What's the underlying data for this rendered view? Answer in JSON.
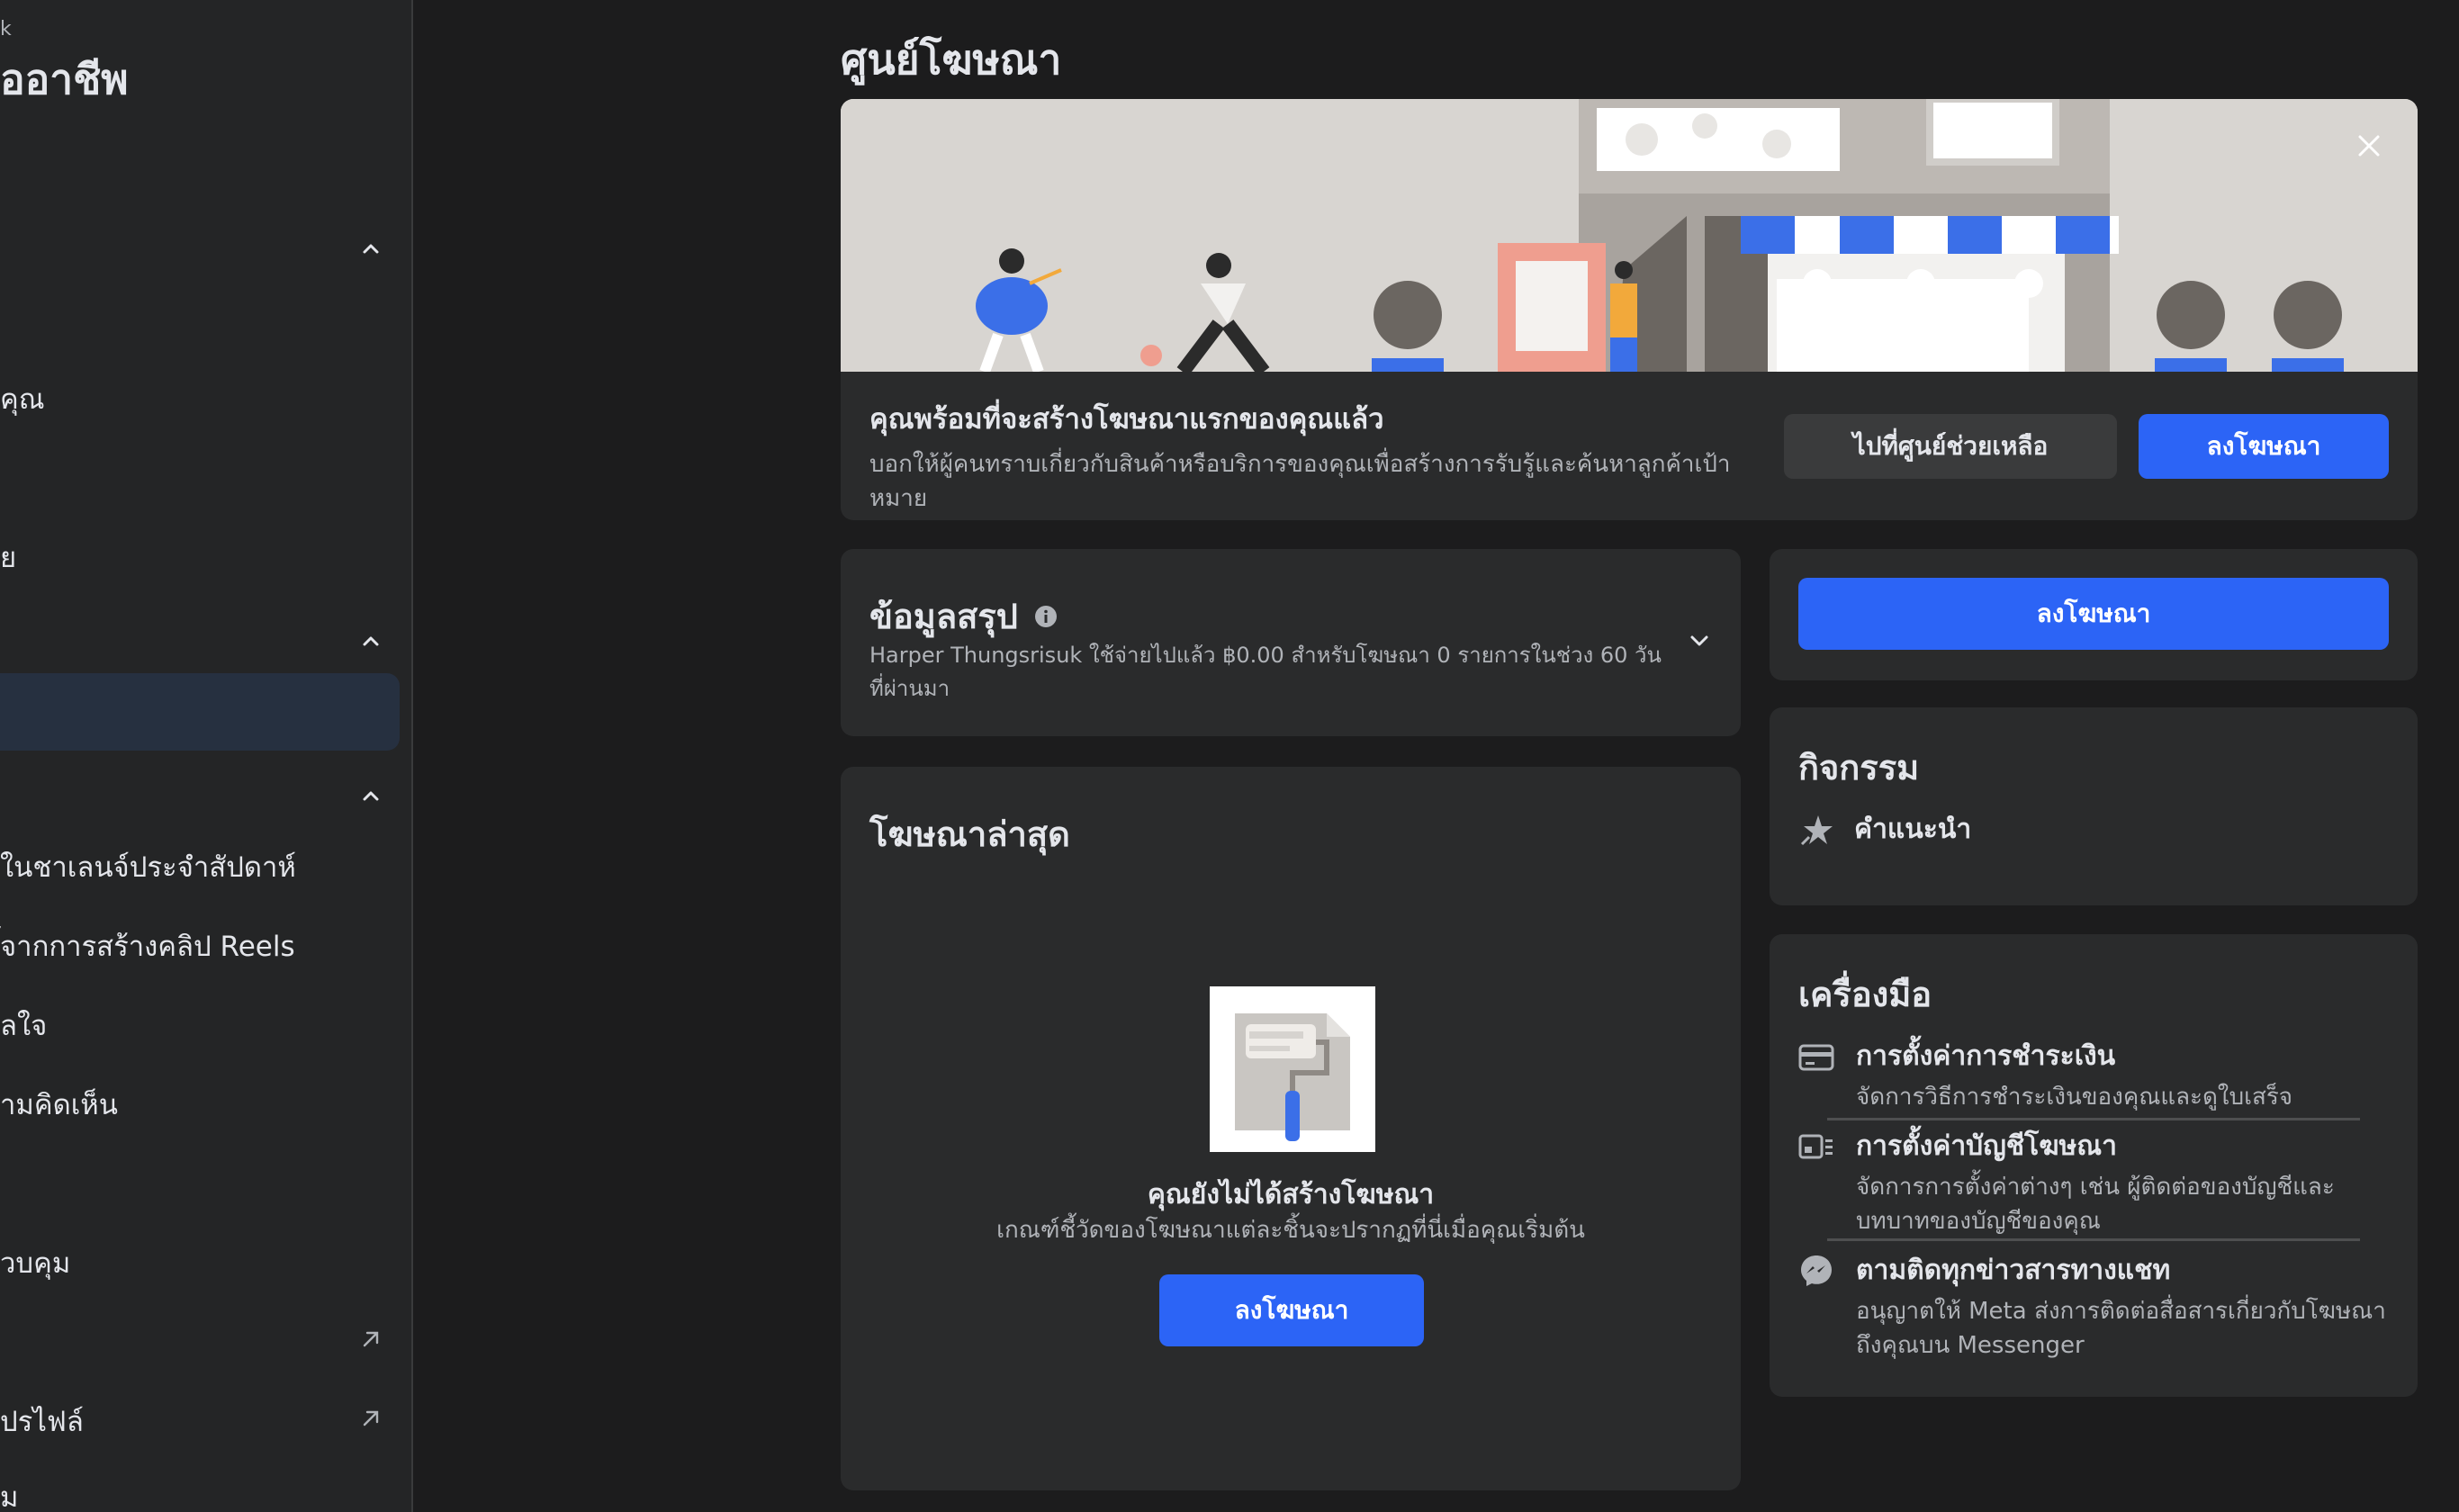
{
  "sidebar": {
    "crumb": "k",
    "title": "ืออาชีพ",
    "items": [
      {
        "label": "คุณ"
      },
      {
        "label": "ย"
      },
      {
        "label": "ในชาเลนจ์ประจำสัปดาห์"
      },
      {
        "label": "้จากการสร้างคลิป Reels"
      },
      {
        "label": "ลใจ"
      },
      {
        "label": "ามคิดเห็น"
      },
      {
        "label": "วบคุม"
      },
      {
        "label": "ปรไฟล์"
      },
      {
        "label": "ม"
      }
    ]
  },
  "page": {
    "title": "ศูนย์โฆษณา"
  },
  "banner": {
    "heading": "คุณพร้อมที่จะสร้างโฆษณาแรกของคุณแล้ว",
    "desc": "บอกให้ผู้คนทราบเกี่ยวกับสินค้าหรือบริการของคุณเพื่อสร้างการรับรู้และค้นหาลูกค้าเป้าหมาย",
    "help_button": "ไปที่ศูนย์ช่วยเหลือ",
    "ad_button": "ลงโฆษณา"
  },
  "summary": {
    "title": "ข้อมูลสรุป",
    "desc": "Harper Thungsrisuk ใช้จ่ายไปแล้ว ฿0.00 สำหรับโฆษณา 0 รายการในช่วง 60 วันที่ผ่านมา"
  },
  "latest": {
    "title": "โฆษณาล่าสุด",
    "empty_heading": "คุณยังไม่ได้สร้างโฆษณา",
    "empty_desc": "เกณฑ์ชี้วัดของโฆษณาแต่ละชิ้นจะปรากฏที่นี่เมื่อคุณเริ่มต้น",
    "button": "ลงโฆษณา"
  },
  "right": {
    "ad_button": "ลงโฆษณา",
    "activity_title": "กิจกรรม",
    "activity_item": "คำแนะนำ",
    "tools_title": "เครื่องมือ",
    "tools": [
      {
        "title": "การตั้งค่าการชำระเงิน",
        "desc": "จัดการวิธีการชำระเงินของคุณและดูใบเสร็จ"
      },
      {
        "title": "การตั้งค่าบัญชีโฆษณา",
        "desc": "จัดการการตั้งค่าต่างๆ เช่น ผู้ติดต่อของบัญชีและบทบาทของบัญชีของคุณ"
      },
      {
        "title": "ตามติดทุกข่าวสารทางแชท",
        "desc": "อนุญาตให้ Meta ส่งการติดต่อสื่อสารเกี่ยวกับโฆษณาถึงคุณบน Messenger"
      }
    ]
  },
  "colors": {
    "accent": "#2c64f6",
    "bg": "#1c1c1d",
    "card": "#2a2b2c",
    "sidebar_active": "#263040"
  }
}
